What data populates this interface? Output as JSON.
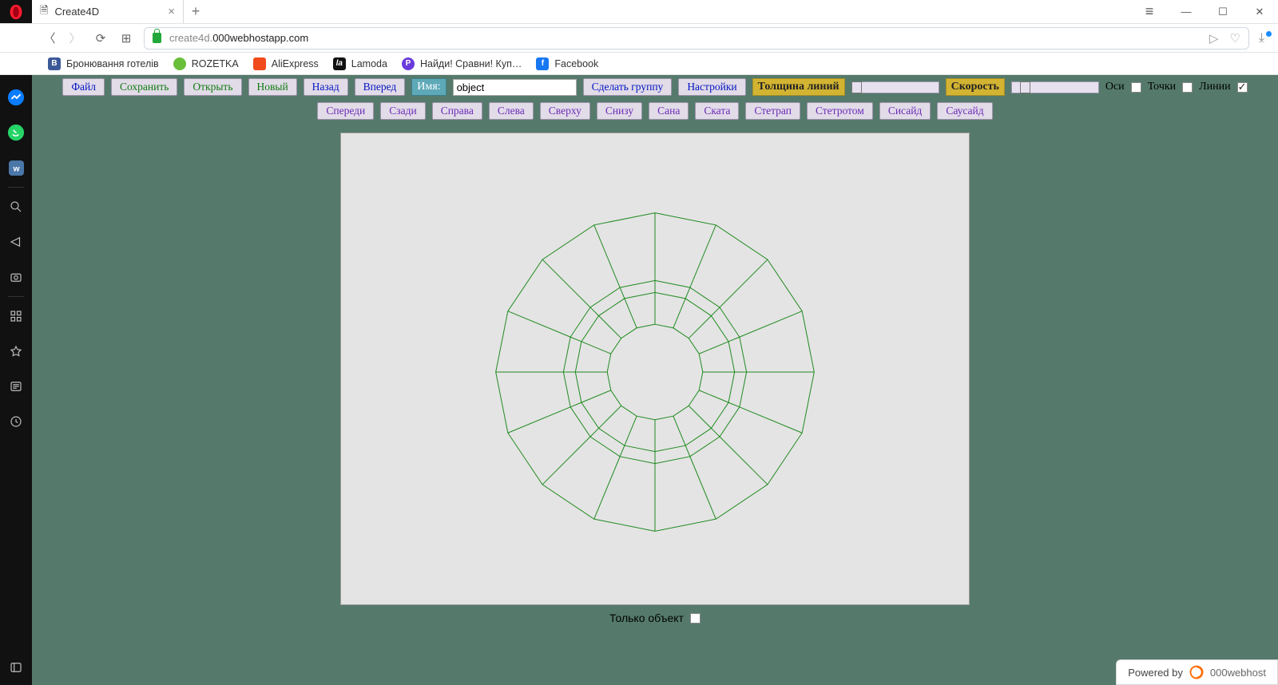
{
  "window": {
    "title": "Create4D"
  },
  "browser": {
    "url_gray": "create4d.",
    "url_domain": "000webhostapp.com",
    "bookmarks": [
      {
        "label": "Бронювання готелів",
        "ic_bg": "#3b5998",
        "ic_txt": "B"
      },
      {
        "label": "ROZETKA",
        "ic_bg": "#6abf3a",
        "ic_txt": ""
      },
      {
        "label": "AliExpress",
        "ic_bg": "#f04a1d",
        "ic_txt": ""
      },
      {
        "label": "Lamoda",
        "ic_bg": "#111",
        "ic_txt": "la"
      },
      {
        "label": "Найди! Сравни! Куп…",
        "ic_bg": "#6a3bdc",
        "ic_txt": "P"
      },
      {
        "label": "Facebook",
        "ic_bg": "#1877f2",
        "ic_txt": "f"
      }
    ]
  },
  "toolbar1": {
    "file": "Файл",
    "save": "Сохранить",
    "open": "Открыть",
    "new_": "Новый",
    "back": "Назад",
    "forward": "Вперед",
    "name_lbl": "Имя:",
    "name_value": "object",
    "group": "Сделать группу",
    "settings": "Настройки",
    "linew_lbl": "Толщина линий",
    "speed_lbl": "Скорость",
    "axes_lbl": "Оси",
    "points_lbl": "Точки",
    "lines_lbl": "Линии"
  },
  "toolbar2": [
    "Спереди",
    "Сзади",
    "Справа",
    "Слева",
    "Сверху",
    "Снизу",
    "Сана",
    "Ската",
    "Стетрап",
    "Стетротом",
    "Сисайд",
    "Саусайд"
  ],
  "bottom": {
    "only_obj": "Только объект"
  },
  "footer": {
    "powered": "Powered by",
    "host": "000webhost"
  }
}
